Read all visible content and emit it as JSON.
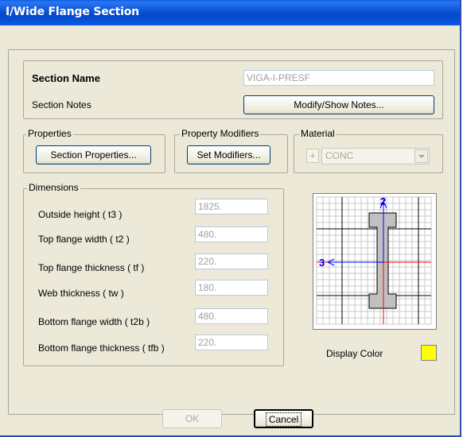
{
  "window": {
    "title": "I/Wide Flange Section"
  },
  "section": {
    "name_label": "Section Name",
    "name_value": "VIGA-I-PRESF",
    "notes_label": "Section Notes",
    "notes_button": "Modify/Show Notes..."
  },
  "properties": {
    "legend": "Properties",
    "button": "Section Properties..."
  },
  "modifiers": {
    "legend": "Property Modifiers",
    "button": "Set Modifiers..."
  },
  "material": {
    "legend": "Material",
    "plus": "+",
    "selected": "CONC"
  },
  "dimensions": {
    "legend": "Dimensions",
    "rows": [
      {
        "label": "Outside height  ( t3 )",
        "value": "1825."
      },
      {
        "label": "Top flange width  ( t2 )",
        "value": "480."
      },
      {
        "label": "Top flange thickness  ( tf )",
        "value": "220."
      },
      {
        "label": "Web thickness  ( tw )",
        "value": "180."
      },
      {
        "label": "Bottom flange width  ( t2b )",
        "value": "480."
      },
      {
        "label": "Bottom flange thickness  ( tfb )",
        "value": "220."
      }
    ]
  },
  "preview": {
    "axis_vertical": "2",
    "axis_horizontal": "3"
  },
  "display_color": {
    "label": "Display Color",
    "color": "#ffff00"
  },
  "buttons": {
    "ok": "OK",
    "cancel": "Cancel"
  },
  "colors": {
    "title_bar": "#0a53d8",
    "axis_red": "#ff0000",
    "axis_blue": "#0000ff",
    "section_fill": "#c0c0c0"
  }
}
